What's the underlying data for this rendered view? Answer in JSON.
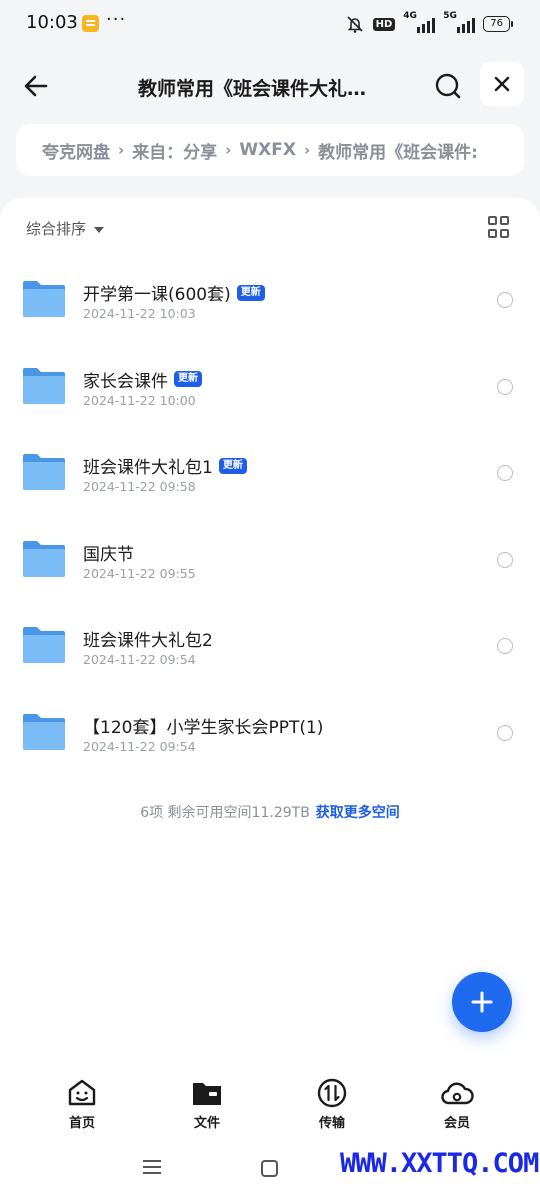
{
  "status_bar": {
    "time": "10:03",
    "network_hd": "HD",
    "sig1": "4G",
    "sig2": "5G",
    "battery": "76"
  },
  "header": {
    "title": "教师常用《班会课件大礼…"
  },
  "breadcrumb": [
    "夸克网盘",
    "来自：分享",
    "WXFX",
    "教师常用《班会课件:"
  ],
  "toolbar": {
    "sort_label": "综合排序"
  },
  "files": [
    {
      "name": "开学第一课(600套)",
      "badge": "更新",
      "date": "2024-11-22 10:03"
    },
    {
      "name": "家长会课件",
      "badge": "更新",
      "date": "2024-11-22 10:00"
    },
    {
      "name": "班会课件大礼包1",
      "badge": "更新",
      "date": "2024-11-22 09:58"
    },
    {
      "name": "国庆节",
      "badge": "",
      "date": "2024-11-22 09:55"
    },
    {
      "name": "班会课件大礼包2",
      "badge": "",
      "date": "2024-11-22 09:54"
    },
    {
      "name": "【120套】小学生家长会PPT(1)",
      "badge": "",
      "date": "2024-11-22 09:54"
    }
  ],
  "footer": {
    "summary": "6项  剩余可用空间11.29TB",
    "more_link": "获取更多空间"
  },
  "nav": {
    "home": "首页",
    "files": "文件",
    "transfer": "传输",
    "member": "会员"
  },
  "watermark": "WWW.XXTTQ.COM",
  "colors": {
    "accent": "#1f5fe8",
    "folder": "#5aa8f2"
  }
}
